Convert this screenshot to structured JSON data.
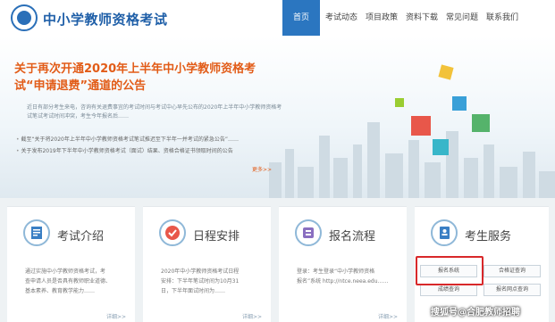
{
  "header": {
    "site_title": "中小学教师资格考试",
    "nav": [
      "首页",
      "考试动态",
      "项目政策",
      "资料下载",
      "常见问题",
      "联系我们"
    ],
    "active_index": 0
  },
  "hero": {
    "title_line1": "关于再次开通2020年上半年中小学教师资格考",
    "title_line2": "试“申请退费”通道的公告",
    "body": "近日有部分考生来电，咨询有关退费事宜的考试时间与考试中心早先公布的2020年上半年中小学教师资格考试笔试考试时间冲突，考生今年报名后……",
    "list": [
      "截至“关于将2020年上半年中小学教师资格考试笔试推迟至下半年一并考试的紧急公告”……",
      "关于发布2019年下半年中小学教师资格考试（面试）结果、资格合格证书领取时间的公告"
    ],
    "more": "更多>>"
  },
  "cards": [
    {
      "title": "考试介绍",
      "icon": "document-icon",
      "text": [
        "通过实施中小学教师资格考试，考",
        "查申请人员是否具有教师职业道德、",
        "基本素养、教育教学能力……"
      ],
      "more": "详细>>"
    },
    {
      "title": "日程安排",
      "icon": "checkmark-icon",
      "text": [
        "2020年中小学教师资格考试日程",
        "安排：下半年笔试时间为10月31",
        "日，下半年面试时间为……"
      ],
      "more": "详细>>"
    },
    {
      "title": "报名流程",
      "icon": "flow-icon",
      "text": [
        "登录：考生登录“中小学教师资格",
        "报名”系统 http://ntce.neea.edu……"
      ],
      "more": "详细>>"
    }
  ],
  "service": {
    "title": "考生服务",
    "icon": "contact-book-icon",
    "buttons": [
      "报名系统",
      "合格证查询",
      "成绩查询",
      "报名网点查询"
    ]
  },
  "watermark": "搜狐号@合肥教师招聘",
  "colors": {
    "brand_blue": "#2b76c0",
    "hero_orange": "#e25c18",
    "highlight_red": "#d8282a"
  }
}
